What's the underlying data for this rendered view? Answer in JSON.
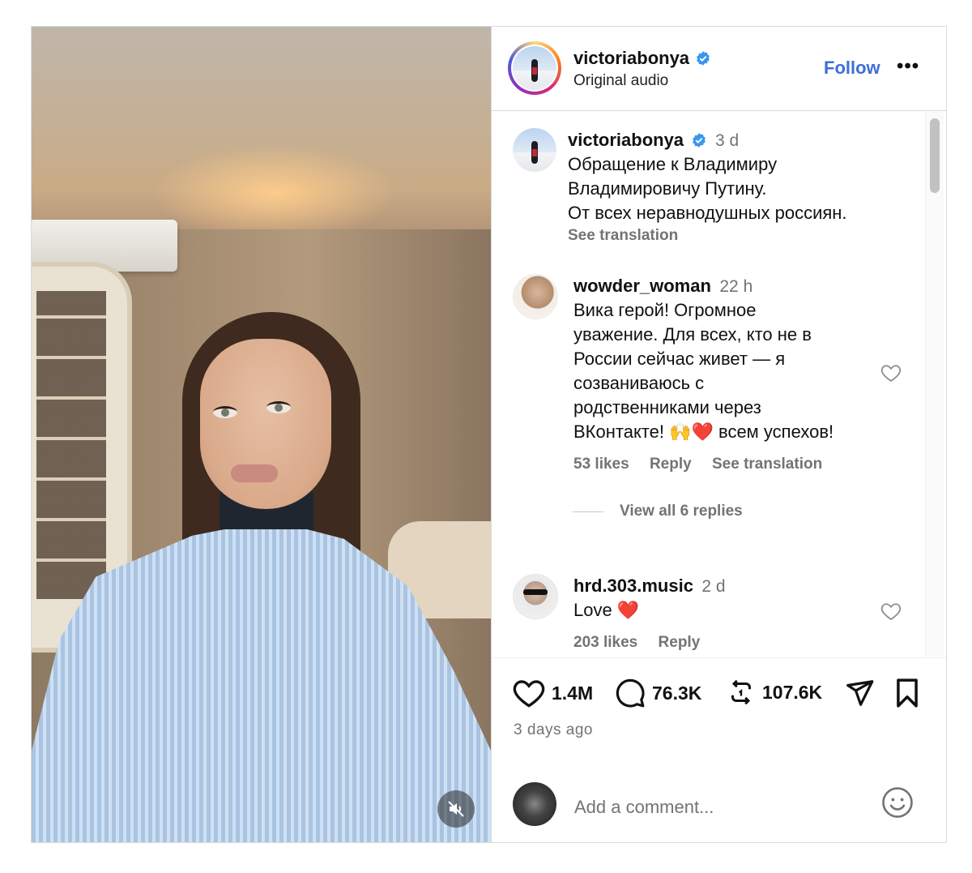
{
  "post": {
    "username": "victoriabonya",
    "audio": "Original audio",
    "follow_label": "Follow",
    "more_label": "•••"
  },
  "caption": {
    "username": "victoriabonya",
    "time": "3 d",
    "lines": [
      "Обращение к Владимиру",
      "Владимировичу Путину.",
      "От всех неравнодушных россиян."
    ],
    "see_translation": "See translation"
  },
  "comments": [
    {
      "username": "wowder_woman",
      "time": "22 h",
      "lines": [
        "Вика герой! Огромное",
        "уважение. Для всех, кто не в",
        "России сейчас живет — я",
        "созваниваюсь с",
        "родственниками через",
        "ВКонтакте! 🙌❤️ всем успехов!"
      ],
      "likes": "53 likes",
      "reply": "Reply",
      "see_translation": "See translation",
      "view_replies": "View all 6 replies"
    },
    {
      "username": "hrd.303.music",
      "time": "2 d",
      "lines": [
        "Love ❤️"
      ],
      "likes": "203 likes",
      "reply": "Reply"
    }
  ],
  "actions": {
    "likes": "1.4M",
    "comments": "76.3K",
    "reposts": "107.6K"
  },
  "posted": "3 days ago",
  "add_comment": {
    "placeholder": "Add a comment..."
  },
  "icons": {
    "verified": "verified-badge-icon",
    "like": "heart-icon",
    "comment": "comment-bubble-icon",
    "repost": "repost-icon",
    "share": "send-icon",
    "save": "bookmark-icon",
    "emoji": "emoji-smile-icon",
    "mute": "speaker-muted-icon"
  },
  "colors": {
    "verified": "#3897f0",
    "follow": "#3b6fd8",
    "muted_text": "#737373"
  }
}
